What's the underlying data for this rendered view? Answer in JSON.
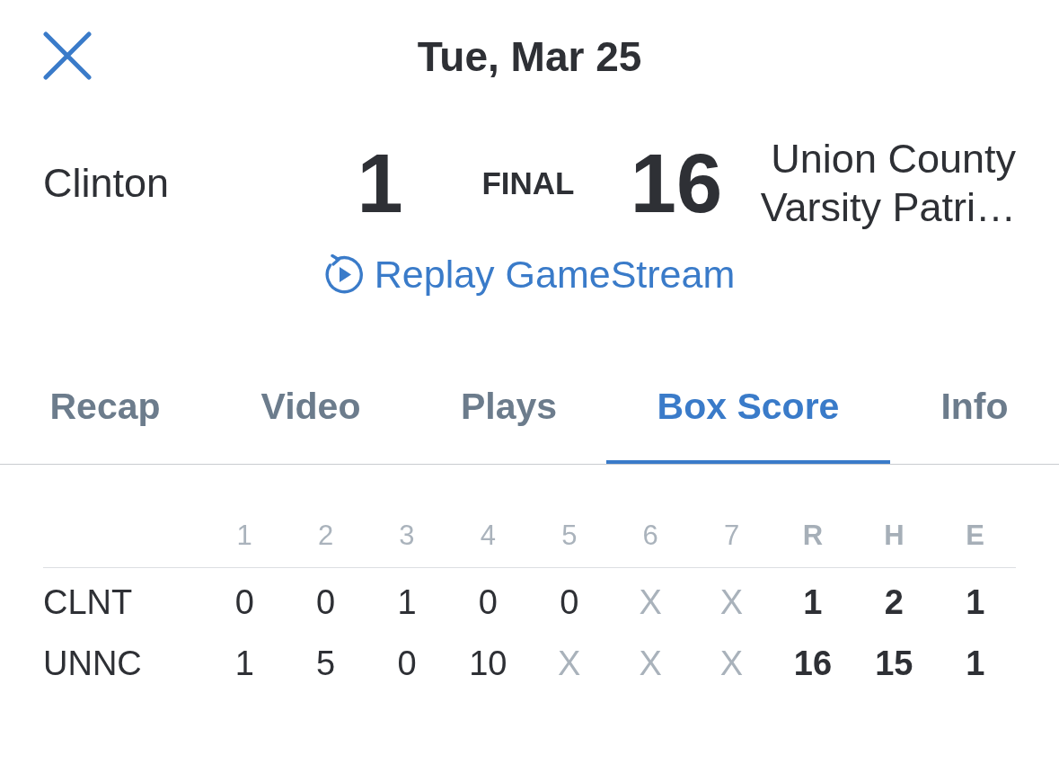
{
  "header": {
    "date": "Tue, Mar 25"
  },
  "game": {
    "away": {
      "name": "Clinton",
      "score": "1"
    },
    "status": "FINAL",
    "home": {
      "score": "16",
      "name": "Union County Varsity Patri…"
    }
  },
  "replay_link": "Replay GameStream",
  "tabs": [
    {
      "label": "Recap",
      "selected": false
    },
    {
      "label": "Video",
      "selected": false
    },
    {
      "label": "Plays",
      "selected": false
    },
    {
      "label": "Box Score",
      "selected": true
    },
    {
      "label": "Info",
      "selected": false
    }
  ],
  "box_score": {
    "columns": [
      {
        "label": "1",
        "kind": "inning"
      },
      {
        "label": "2",
        "kind": "inning"
      },
      {
        "label": "3",
        "kind": "inning"
      },
      {
        "label": "4",
        "kind": "inning"
      },
      {
        "label": "5",
        "kind": "inning"
      },
      {
        "label": "6",
        "kind": "inning"
      },
      {
        "label": "7",
        "kind": "inning"
      },
      {
        "label": "R",
        "kind": "total"
      },
      {
        "label": "H",
        "kind": "total"
      },
      {
        "label": "E",
        "kind": "total"
      }
    ],
    "rows": [
      {
        "team": "CLNT",
        "cells": [
          {
            "value": "0",
            "kind": "score"
          },
          {
            "value": "0",
            "kind": "score"
          },
          {
            "value": "1",
            "kind": "score"
          },
          {
            "value": "0",
            "kind": "score"
          },
          {
            "value": "0",
            "kind": "score"
          },
          {
            "value": "X",
            "kind": "unplayed"
          },
          {
            "value": "X",
            "kind": "unplayed"
          },
          {
            "value": "1",
            "kind": "score"
          },
          {
            "value": "2",
            "kind": "score"
          },
          {
            "value": "1",
            "kind": "score"
          }
        ]
      },
      {
        "team": "UNNC",
        "cells": [
          {
            "value": "1",
            "kind": "score"
          },
          {
            "value": "5",
            "kind": "score"
          },
          {
            "value": "0",
            "kind": "score"
          },
          {
            "value": "10",
            "kind": "score"
          },
          {
            "value": "X",
            "kind": "unplayed"
          },
          {
            "value": "X",
            "kind": "unplayed"
          },
          {
            "value": "X",
            "kind": "unplayed"
          },
          {
            "value": "16",
            "kind": "score"
          },
          {
            "value": "15",
            "kind": "score"
          },
          {
            "value": "1",
            "kind": "score"
          }
        ]
      }
    ]
  }
}
